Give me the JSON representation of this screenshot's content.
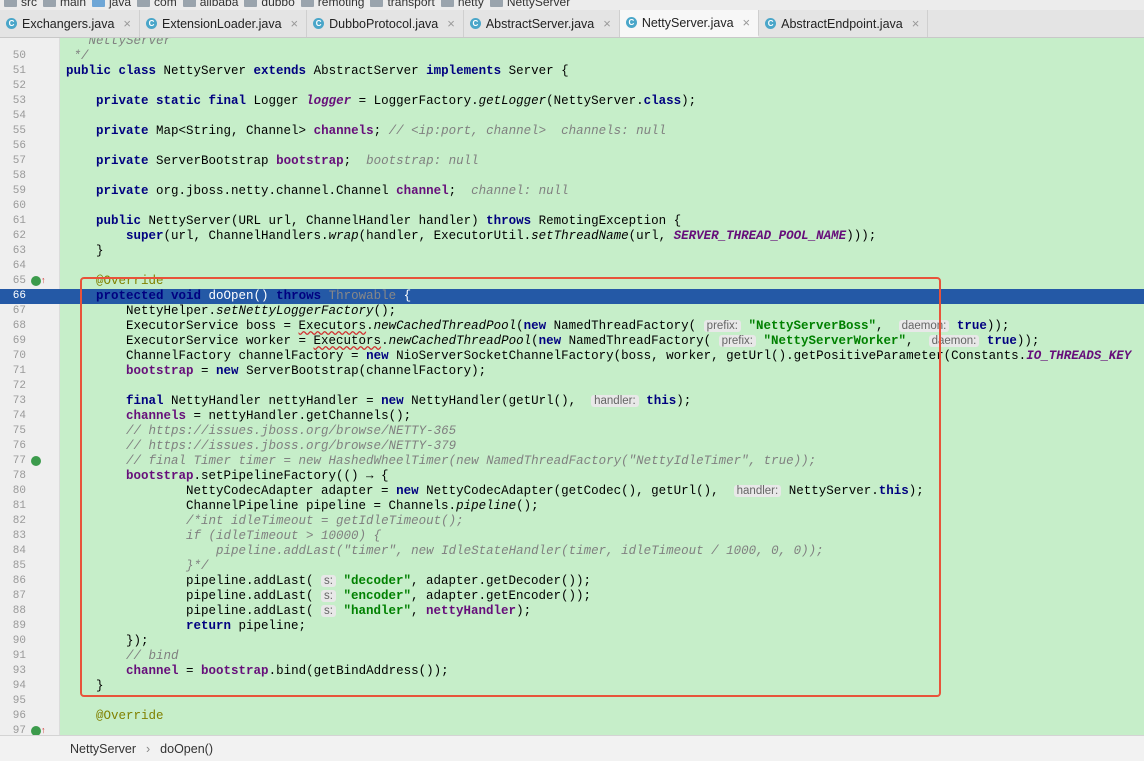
{
  "breadcrumb": [
    "src",
    "main",
    "java",
    "com",
    "alibaba",
    "dubbo",
    "remoting",
    "transport",
    "netty",
    "NettyServer"
  ],
  "tabs": [
    {
      "label": "Exchangers.java",
      "active": false
    },
    {
      "label": "ExtensionLoader.java",
      "active": false
    },
    {
      "label": "DubboProtocol.java",
      "active": false
    },
    {
      "label": "AbstractServer.java",
      "active": false
    },
    {
      "label": "NettyServer.java",
      "active": true
    },
    {
      "label": "AbstractEndpoint.java",
      "active": false
    }
  ],
  "selected_line": 66,
  "lines": [
    {
      "n": "",
      "segs": [
        {
          "t": "   NettyServer",
          "c": "cm"
        }
      ]
    },
    {
      "n": "50",
      "segs": [
        {
          "t": " */",
          "c": "cm"
        }
      ]
    },
    {
      "n": "51",
      "segs": [
        {
          "t": "public class ",
          "c": "kw"
        },
        {
          "t": "NettyServer "
        },
        {
          "t": "extends ",
          "c": "kw"
        },
        {
          "t": "AbstractServer "
        },
        {
          "t": "implements ",
          "c": "kw"
        },
        {
          "t": "Server {"
        }
      ]
    },
    {
      "n": "52",
      "segs": []
    },
    {
      "n": "53",
      "segs": [
        {
          "t": "    "
        },
        {
          "t": "private static final ",
          "c": "kw"
        },
        {
          "t": "Logger "
        },
        {
          "t": "logger",
          "c": "sfi"
        },
        {
          "t": " = LoggerFactory."
        },
        {
          "t": "getLogger",
          "c": "stm"
        },
        {
          "t": "(NettyServer."
        },
        {
          "t": "class",
          "c": "kw"
        },
        {
          "t": ");"
        }
      ]
    },
    {
      "n": "54",
      "segs": []
    },
    {
      "n": "55",
      "segs": [
        {
          "t": "    "
        },
        {
          "t": "private ",
          "c": "kw"
        },
        {
          "t": "Map<String, Channel> "
        },
        {
          "t": "channels",
          "c": "fld"
        },
        {
          "t": "; "
        },
        {
          "t": "// <ip:port, channel>  channels: null",
          "c": "cm"
        }
      ]
    },
    {
      "n": "56",
      "segs": []
    },
    {
      "n": "57",
      "segs": [
        {
          "t": "    "
        },
        {
          "t": "private ",
          "c": "kw"
        },
        {
          "t": "ServerBootstrap "
        },
        {
          "t": "bootstrap",
          "c": "fld"
        },
        {
          "t": ";  "
        },
        {
          "t": "bootstrap: null",
          "c": "cm"
        }
      ]
    },
    {
      "n": "58",
      "segs": []
    },
    {
      "n": "59",
      "segs": [
        {
          "t": "    "
        },
        {
          "t": "private ",
          "c": "kw"
        },
        {
          "t": "org.jboss.netty.channel.Channel "
        },
        {
          "t": "channel",
          "c": "fld"
        },
        {
          "t": ";  "
        },
        {
          "t": "channel: null",
          "c": "cm"
        }
      ]
    },
    {
      "n": "60",
      "segs": []
    },
    {
      "n": "61",
      "segs": [
        {
          "t": "    "
        },
        {
          "t": "public ",
          "c": "kw"
        },
        {
          "t": "NettyServer(URL url, ChannelHandler handler) "
        },
        {
          "t": "throws ",
          "c": "kw"
        },
        {
          "t": "RemotingException {"
        }
      ]
    },
    {
      "n": "62",
      "segs": [
        {
          "t": "        "
        },
        {
          "t": "super",
          "c": "kw"
        },
        {
          "t": "(url, ChannelHandlers."
        },
        {
          "t": "wrap",
          "c": "stm"
        },
        {
          "t": "(handler, ExecutorUtil."
        },
        {
          "t": "setThreadName",
          "c": "stm"
        },
        {
          "t": "(url, "
        },
        {
          "t": "SERVER_THREAD_POOL_NAME",
          "c": "sfi"
        },
        {
          "t": ")));"
        }
      ]
    },
    {
      "n": "63",
      "segs": [
        {
          "t": "    }"
        }
      ]
    },
    {
      "n": "64",
      "segs": []
    },
    {
      "n": "65",
      "segs": [
        {
          "t": "    "
        },
        {
          "t": "@Override",
          "c": "ann"
        }
      ]
    },
    {
      "n": "66",
      "segs": [
        {
          "t": "    "
        },
        {
          "t": "protected void ",
          "c": "kw"
        },
        {
          "t": "doOpen() "
        },
        {
          "t": "throws ",
          "c": "kw"
        },
        {
          "t": "Throwable",
          "c": "gry"
        },
        {
          "t": " {"
        }
      ]
    },
    {
      "n": "67",
      "segs": [
        {
          "t": "        NettyHelper."
        },
        {
          "t": "setNettyLoggerFactory",
          "c": "stm"
        },
        {
          "t": "();"
        }
      ]
    },
    {
      "n": "68",
      "segs": [
        {
          "t": "        ExecutorService boss = "
        },
        {
          "t": "Executors",
          "c": "und"
        },
        {
          "t": "."
        },
        {
          "t": "newCachedThreadPool",
          "c": "stm"
        },
        {
          "t": "("
        },
        {
          "t": "new ",
          "c": "kw"
        },
        {
          "t": "NamedThreadFactory( "
        },
        {
          "t": "prefix:",
          "c": "hint"
        },
        {
          "t": " "
        },
        {
          "t": "\"NettyServerBoss\"",
          "c": "str"
        },
        {
          "t": ",  "
        },
        {
          "t": "daemon:",
          "c": "hint"
        },
        {
          "t": " "
        },
        {
          "t": "true",
          "c": "kw"
        },
        {
          "t": "));"
        }
      ]
    },
    {
      "n": "69",
      "segs": [
        {
          "t": "        ExecutorService worker = "
        },
        {
          "t": "Executors",
          "c": "und"
        },
        {
          "t": "."
        },
        {
          "t": "newCachedThreadPool",
          "c": "stm"
        },
        {
          "t": "("
        },
        {
          "t": "new ",
          "c": "kw"
        },
        {
          "t": "NamedThreadFactory( "
        },
        {
          "t": "prefix:",
          "c": "hint"
        },
        {
          "t": " "
        },
        {
          "t": "\"NettyServerWorker\"",
          "c": "str"
        },
        {
          "t": ",  "
        },
        {
          "t": "daemon:",
          "c": "hint"
        },
        {
          "t": " "
        },
        {
          "t": "true",
          "c": "kw"
        },
        {
          "t": "));"
        }
      ]
    },
    {
      "n": "70",
      "segs": [
        {
          "t": "        ChannelFactory channelFactory = "
        },
        {
          "t": "new ",
          "c": "kw"
        },
        {
          "t": "NioServerSocketChannelFactory(boss, worker, getUrl().getPositiveParameter(Constants."
        },
        {
          "t": "IO_THREADS_KEY",
          "c": "sfi"
        }
      ]
    },
    {
      "n": "71",
      "segs": [
        {
          "t": "        "
        },
        {
          "t": "bootstrap",
          "c": "fld"
        },
        {
          "t": " = "
        },
        {
          "t": "new ",
          "c": "kw"
        },
        {
          "t": "ServerBootstrap(channelFactory);"
        }
      ]
    },
    {
      "n": "72",
      "segs": []
    },
    {
      "n": "73",
      "segs": [
        {
          "t": "        "
        },
        {
          "t": "final ",
          "c": "kw"
        },
        {
          "t": "NettyHandler nettyHandler = "
        },
        {
          "t": "new ",
          "c": "kw"
        },
        {
          "t": "NettyHandler(getUrl(),  "
        },
        {
          "t": "handler:",
          "c": "hint"
        },
        {
          "t": " "
        },
        {
          "t": "this",
          "c": "kw"
        },
        {
          "t": ");"
        }
      ]
    },
    {
      "n": "74",
      "segs": [
        {
          "t": "        "
        },
        {
          "t": "channels",
          "c": "fld"
        },
        {
          "t": " = nettyHandler.getChannels();"
        }
      ]
    },
    {
      "n": "75",
      "segs": [
        {
          "t": "        "
        },
        {
          "t": "// https://issues.jboss.org/browse/NETTY-365",
          "c": "cm"
        }
      ]
    },
    {
      "n": "76",
      "segs": [
        {
          "t": "        "
        },
        {
          "t": "// https://issues.jboss.org/browse/NETTY-379",
          "c": "cm"
        }
      ]
    },
    {
      "n": "77",
      "segs": [
        {
          "t": "        "
        },
        {
          "t": "// final Timer timer = new HashedWheelTimer(new NamedThreadFactory(\"NettyIdleTimer\", true));",
          "c": "cm"
        }
      ]
    },
    {
      "n": "78",
      "segs": [
        {
          "t": "        "
        },
        {
          "t": "bootstrap",
          "c": "fld"
        },
        {
          "t": ".setPipelineFactory(() → {"
        }
      ]
    },
    {
      "n": "80",
      "segs": [
        {
          "t": "                NettyCodecAdapter adapter = "
        },
        {
          "t": "new ",
          "c": "kw"
        },
        {
          "t": "NettyCodecAdapter(getCodec(), getUrl(),  "
        },
        {
          "t": "handler:",
          "c": "hint"
        },
        {
          "t": " NettyServer."
        },
        {
          "t": "this",
          "c": "kw"
        },
        {
          "t": ");"
        }
      ]
    },
    {
      "n": "81",
      "segs": [
        {
          "t": "                ChannelPipeline pipeline = Channels."
        },
        {
          "t": "pipeline",
          "c": "stm"
        },
        {
          "t": "();"
        }
      ]
    },
    {
      "n": "82",
      "segs": [
        {
          "t": "                "
        },
        {
          "t": "/*int idleTimeout = getIdleTimeout();",
          "c": "cm"
        }
      ]
    },
    {
      "n": "83",
      "segs": [
        {
          "t": "                "
        },
        {
          "t": "if (idleTimeout > 10000) {",
          "c": "cm"
        }
      ]
    },
    {
      "n": "84",
      "segs": [
        {
          "t": "                    "
        },
        {
          "t": "pipeline.addLast(\"timer\", new IdleStateHandler(timer, idleTimeout / 1000, 0, 0));",
          "c": "cm"
        }
      ]
    },
    {
      "n": "85",
      "segs": [
        {
          "t": "                "
        },
        {
          "t": "}*/",
          "c": "cm"
        }
      ]
    },
    {
      "n": "86",
      "segs": [
        {
          "t": "                pipeline.addLast( "
        },
        {
          "t": "s:",
          "c": "hint"
        },
        {
          "t": " "
        },
        {
          "t": "\"decoder\"",
          "c": "str"
        },
        {
          "t": ", adapter.getDecoder());"
        }
      ]
    },
    {
      "n": "87",
      "segs": [
        {
          "t": "                pipeline.addLast( "
        },
        {
          "t": "s:",
          "c": "hint"
        },
        {
          "t": " "
        },
        {
          "t": "\"encoder\"",
          "c": "str"
        },
        {
          "t": ", adapter.getEncoder());"
        }
      ]
    },
    {
      "n": "88",
      "segs": [
        {
          "t": "                pipeline.addLast( "
        },
        {
          "t": "s:",
          "c": "hint"
        },
        {
          "t": " "
        },
        {
          "t": "\"handler\"",
          "c": "str"
        },
        {
          "t": ", "
        },
        {
          "t": "nettyHandler",
          "c": "fld"
        },
        {
          "t": ");"
        }
      ]
    },
    {
      "n": "89",
      "segs": [
        {
          "t": "                "
        },
        {
          "t": "return ",
          "c": "kw"
        },
        {
          "t": "pipeline;"
        }
      ]
    },
    {
      "n": "90",
      "segs": [
        {
          "t": "        });"
        }
      ]
    },
    {
      "n": "91",
      "segs": [
        {
          "t": "        "
        },
        {
          "t": "// bind",
          "c": "cm"
        }
      ]
    },
    {
      "n": "93",
      "segs": [
        {
          "t": "        "
        },
        {
          "t": "channel",
          "c": "fld"
        },
        {
          "t": " = "
        },
        {
          "t": "bootstrap",
          "c": "fld"
        },
        {
          "t": ".bind(getBindAddress());"
        }
      ]
    },
    {
      "n": "94",
      "segs": [
        {
          "t": "    }"
        }
      ]
    },
    {
      "n": "95",
      "segs": []
    },
    {
      "n": "96",
      "segs": [
        {
          "t": "    "
        },
        {
          "t": "@Override",
          "c": "ann"
        }
      ]
    },
    {
      "n": "97",
      "segs": []
    }
  ],
  "gutter_icons": [
    {
      "line": "65",
      "icon": "override-method-icon"
    },
    {
      "line": "66",
      "icon": "breakpoint-icon"
    },
    {
      "line": "77",
      "icon": "lambda-icon"
    },
    {
      "line": "97",
      "icon": "override-method-icon"
    }
  ],
  "status_bar": {
    "class_name": "NettyServer",
    "method_name": "doOpen()"
  }
}
